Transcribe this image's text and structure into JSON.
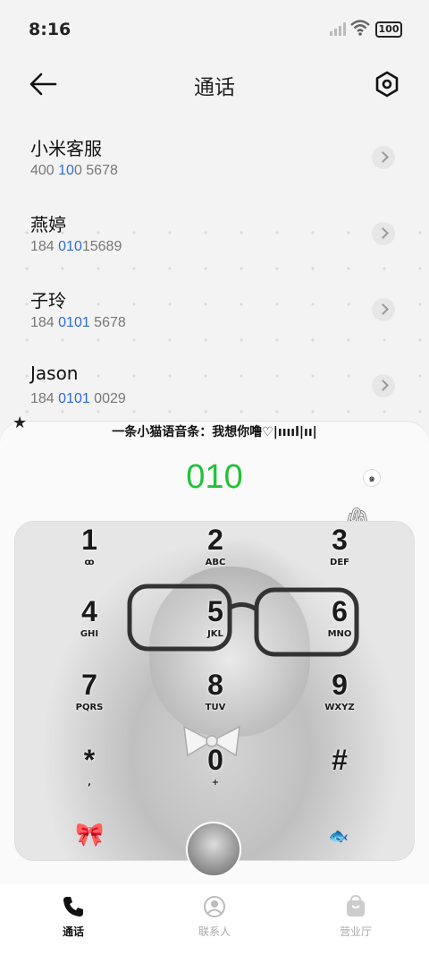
{
  "status": {
    "time": "8:16",
    "battery": "100"
  },
  "header": {
    "title": "通话"
  },
  "contacts": [
    {
      "name": "小米客服",
      "num_pre": "400 ",
      "num_hl": "10",
      "num_post": "0 5678"
    },
    {
      "name": "燕婷",
      "num_pre": "184 ",
      "num_hl": "010",
      "num_post": "15689"
    },
    {
      "name": "子玲",
      "num_pre": "184 ",
      "num_hl": "0101",
      "num_post": " 5678"
    },
    {
      "name": "Jason",
      "num_pre": "184 ",
      "num_hl": "0101",
      "num_post": " 0029"
    }
  ],
  "dialer": {
    "banner": "一条小猫语音条：我想你噜♡|ııııl|ıı|",
    "dialed": "010",
    "keys": [
      {
        "digit": "1",
        "letters": "ꝏ"
      },
      {
        "digit": "2",
        "letters": "ABC"
      },
      {
        "digit": "3",
        "letters": "DEF"
      },
      {
        "digit": "4",
        "letters": "GHI"
      },
      {
        "digit": "5",
        "letters": "JKL"
      },
      {
        "digit": "6",
        "letters": "MNO"
      },
      {
        "digit": "7",
        "letters": "PQRS"
      },
      {
        "digit": "8",
        "letters": "TUV"
      },
      {
        "digit": "9",
        "letters": "WXYZ"
      },
      {
        "digit": "*",
        "letters": ","
      },
      {
        "digit": "0",
        "letters": "+"
      },
      {
        "digit": "#",
        "letters": ""
      }
    ]
  },
  "nav": [
    {
      "label": "通话",
      "icon": "phone-icon",
      "active": true
    },
    {
      "label": "联系人",
      "icon": "contact-icon",
      "active": false
    },
    {
      "label": "营业厅",
      "icon": "shop-icon",
      "active": false
    }
  ],
  "colors": {
    "accent": "#22c23a",
    "highlight": "#2b6cd4"
  }
}
